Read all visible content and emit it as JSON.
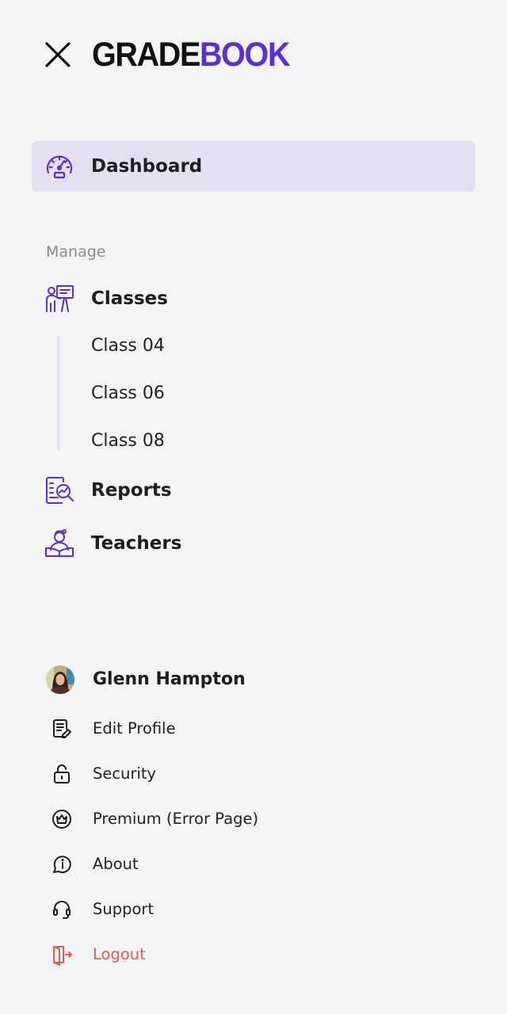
{
  "header": {
    "logo_part1": "GRADE",
    "logo_part2": "BOOK"
  },
  "nav": {
    "dashboard_label": "Dashboard",
    "section_label": "Manage",
    "classes_label": "Classes",
    "class_items": [
      "Class 04",
      "Class 06",
      "Class 08"
    ],
    "reports_label": "Reports",
    "teachers_label": "Teachers"
  },
  "profile": {
    "name": "Glenn Hampton",
    "menu": [
      {
        "label": "Edit Profile",
        "icon": "edit-profile-icon"
      },
      {
        "label": "Security",
        "icon": "lock-icon"
      },
      {
        "label": "Premium (Error Page)",
        "icon": "crown-icon"
      },
      {
        "label": "About",
        "icon": "info-icon"
      },
      {
        "label": "Support",
        "icon": "headset-icon"
      },
      {
        "label": "Logout",
        "icon": "logout-icon"
      }
    ]
  },
  "colors": {
    "accent": "#5b2ed6",
    "active_bg": "#e5e0f1",
    "background": "#f4f4f4",
    "logout": "#e05a5a"
  }
}
